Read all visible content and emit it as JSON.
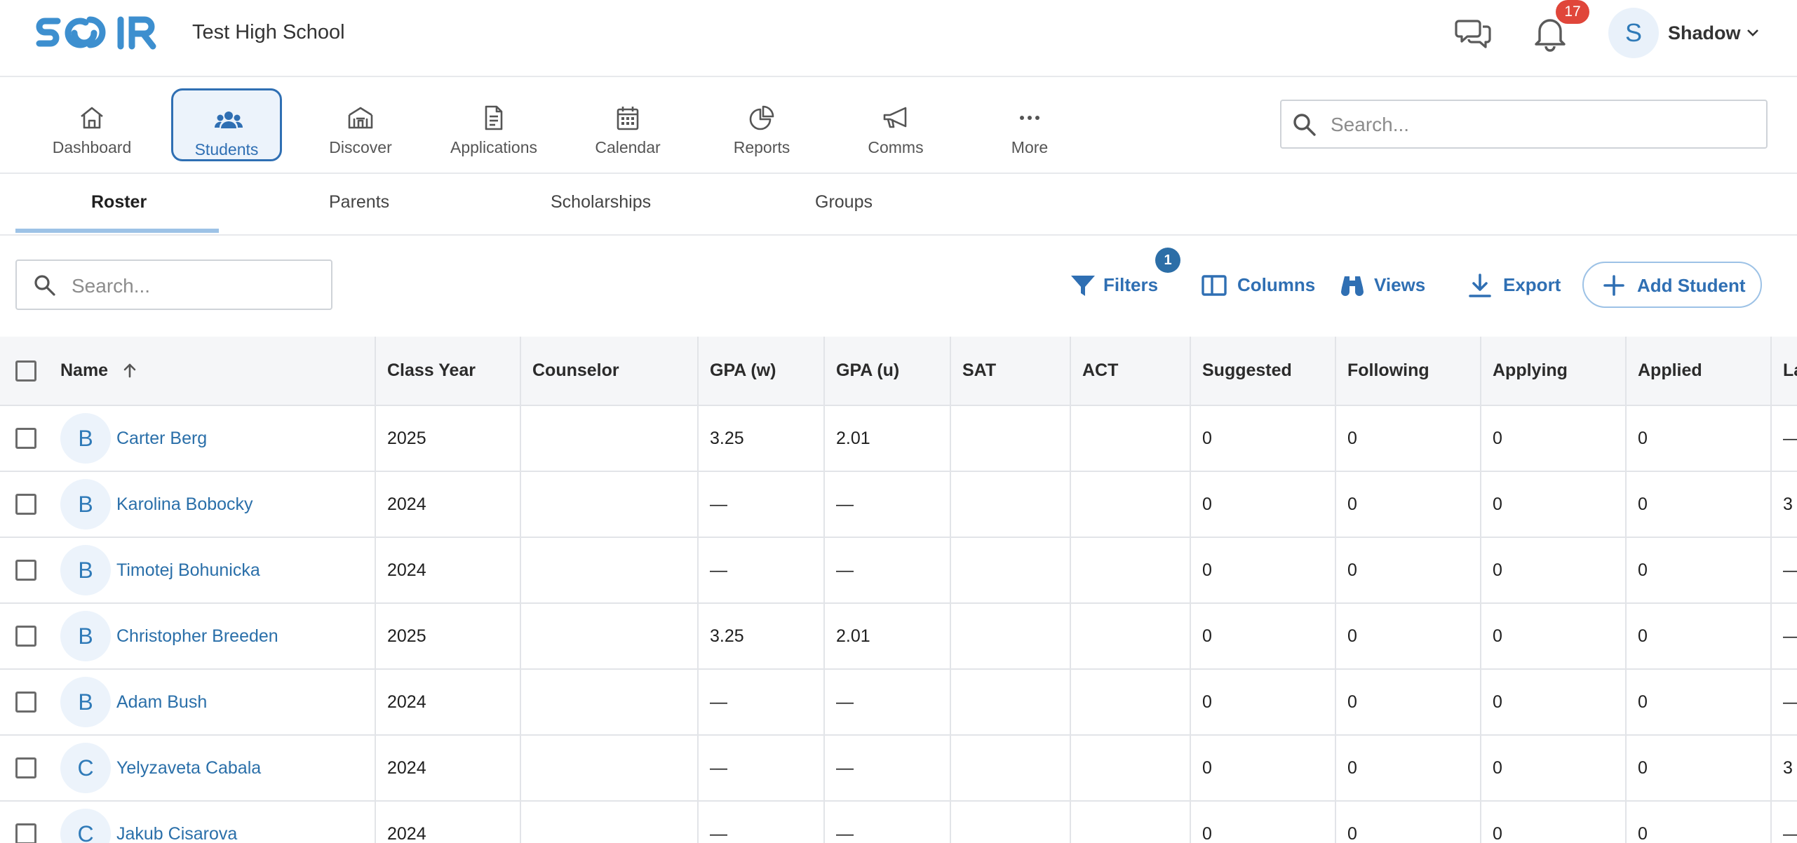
{
  "app": {
    "school_name": "Test High School",
    "notifications_count": "17",
    "user_initial": "S",
    "user_name": "Shadow"
  },
  "nav": {
    "items": [
      {
        "label": "Dashboard",
        "icon": "home-icon"
      },
      {
        "label": "Students",
        "icon": "users-icon",
        "active": true
      },
      {
        "label": "Discover",
        "icon": "university-icon"
      },
      {
        "label": "Applications",
        "icon": "document-icon"
      },
      {
        "label": "Calendar",
        "icon": "calendar-icon"
      },
      {
        "label": "Reports",
        "icon": "pie-chart-icon"
      },
      {
        "label": "Comms",
        "icon": "megaphone-icon"
      },
      {
        "label": "More",
        "icon": "more-dots-icon"
      }
    ],
    "search_placeholder": "Search..."
  },
  "subtabs": [
    "Roster",
    "Parents",
    "Scholarships",
    "Groups"
  ],
  "toolbar": {
    "search_placeholder": "Search...",
    "filters_label": "Filters",
    "filters_count": "1",
    "columns_label": "Columns",
    "views_label": "Views",
    "export_label": "Export",
    "add_student_label": "Add Student"
  },
  "table": {
    "columns": [
      "Name",
      "Class Year",
      "Counselor",
      "GPA (w)",
      "GPA (u)",
      "SAT",
      "ACT",
      "Suggested",
      "Following",
      "Applying",
      "Applied",
      "La"
    ],
    "rows": [
      {
        "initial": "B",
        "name": "Carter Berg",
        "class_year": "2025",
        "counselor": "",
        "gpa_w": "3.25",
        "gpa_u": "2.01",
        "sat": "",
        "act": "",
        "suggested": "0",
        "following": "0",
        "applying": "0",
        "applied": "0",
        "last": "—"
      },
      {
        "initial": "B",
        "name": "Karolina Bobocky",
        "class_year": "2024",
        "counselor": "",
        "gpa_w": "—",
        "gpa_u": "—",
        "sat": "",
        "act": "",
        "suggested": "0",
        "following": "0",
        "applying": "0",
        "applied": "0",
        "last": "3"
      },
      {
        "initial": "B",
        "name": "Timotej Bohunicka",
        "class_year": "2024",
        "counselor": "",
        "gpa_w": "—",
        "gpa_u": "—",
        "sat": "",
        "act": "",
        "suggested": "0",
        "following": "0",
        "applying": "0",
        "applied": "0",
        "last": "—"
      },
      {
        "initial": "B",
        "name": "Christopher Breeden",
        "class_year": "2025",
        "counselor": "",
        "gpa_w": "3.25",
        "gpa_u": "2.01",
        "sat": "",
        "act": "",
        "suggested": "0",
        "following": "0",
        "applying": "0",
        "applied": "0",
        "last": "—"
      },
      {
        "initial": "B",
        "name": "Adam Bush",
        "class_year": "2024",
        "counselor": "",
        "gpa_w": "—",
        "gpa_u": "—",
        "sat": "",
        "act": "",
        "suggested": "0",
        "following": "0",
        "applying": "0",
        "applied": "0",
        "last": "—"
      },
      {
        "initial": "C",
        "name": "Yelyzaveta Cabala",
        "class_year": "2024",
        "counselor": "",
        "gpa_w": "—",
        "gpa_u": "—",
        "sat": "",
        "act": "",
        "suggested": "0",
        "following": "0",
        "applying": "0",
        "applied": "0",
        "last": "3"
      },
      {
        "initial": "C",
        "name": "Jakub Cisarova",
        "class_year": "2024",
        "counselor": "",
        "gpa_w": "—",
        "gpa_u": "—",
        "sat": "",
        "act": "",
        "suggested": "0",
        "following": "0",
        "applying": "0",
        "applied": "0",
        "last": "—"
      }
    ]
  },
  "colors": {
    "brand": "#3d8fcf",
    "accent": "#2f6fb3",
    "badge_red": "#e0463a",
    "badge_blue": "#2c6ea7"
  }
}
